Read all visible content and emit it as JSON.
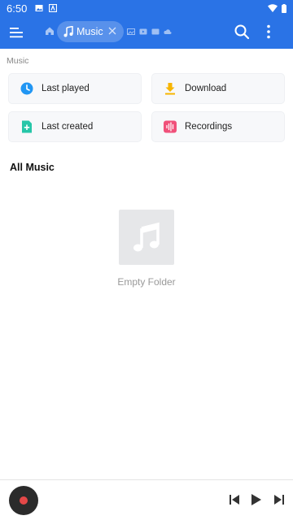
{
  "status_bar": {
    "time": "6:50"
  },
  "app_bar": {
    "tab_label": "Music"
  },
  "path_label": "Music",
  "shortcuts": [
    {
      "label": "Last played",
      "icon": "clock-icon",
      "color": "#2196f3"
    },
    {
      "label": "Download",
      "icon": "download-icon",
      "color": "#f7b500"
    },
    {
      "label": "Last created",
      "icon": "add-file-icon",
      "color": "#26c6a8"
    },
    {
      "label": "Recordings",
      "icon": "waveform-icon",
      "color": "#f0517a"
    }
  ],
  "section_title": "All Music",
  "empty_state": {
    "text": "Empty Folder",
    "icon": "music-note-icon"
  },
  "colors": {
    "accent": "#2a73e6",
    "disc_center": "#e54848"
  }
}
